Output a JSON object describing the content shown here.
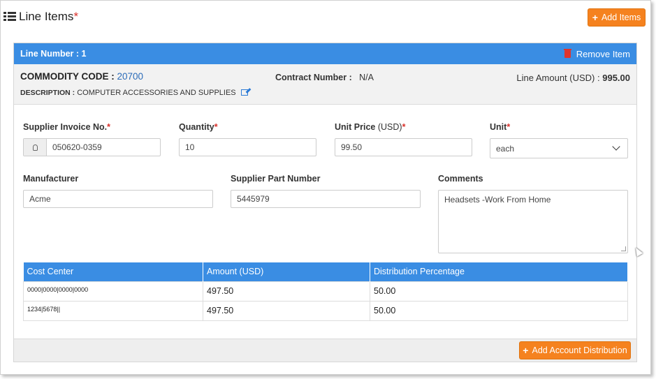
{
  "header": {
    "title": "Line Items",
    "required_mark": "*",
    "add_items_label": "Add Items"
  },
  "line_item": {
    "label": "Line Number : 1",
    "remove_label": "Remove Item",
    "commodity_code_label": "COMMODITY CODE :",
    "commodity_code_value": "20700",
    "description_label": "DESCRIPTION :",
    "description_value": "COMPUTER ACCESSORIES AND SUPPLIES",
    "contract_label": "Contract Number :",
    "contract_value": "N/A",
    "amount_label": "Line Amount (USD) :",
    "amount_value": "995.00"
  },
  "fields": {
    "supplier_invoice": {
      "label": "Supplier Invoice No.",
      "value": "050620-0359"
    },
    "quantity": {
      "label": "Quantity",
      "value": "10"
    },
    "unit_price": {
      "label": "Unit Price",
      "label_suffix": "(USD)",
      "value": "99.50"
    },
    "unit": {
      "label": "Unit",
      "value": "each"
    },
    "manufacturer": {
      "label": "Manufacturer",
      "value": "Acme"
    },
    "supplier_part": {
      "label": "Supplier Part Number",
      "value": "5445979"
    },
    "comments": {
      "label": "Comments",
      "value": "Headsets -Work From Home"
    }
  },
  "distribution": {
    "headers": [
      "Cost Center",
      "Amount (USD)",
      "Distribution Percentage"
    ],
    "rows": [
      [
        "0000|0000|0000|0000",
        "497.50",
        "50.00"
      ],
      [
        "1234|5678||",
        "497.50",
        "50.00"
      ]
    ],
    "add_label": "Add Account Distribution"
  },
  "colors": {
    "accent_blue": "#3a8de3",
    "button_orange": "#f5821f",
    "required_red": "#d9302a"
  }
}
